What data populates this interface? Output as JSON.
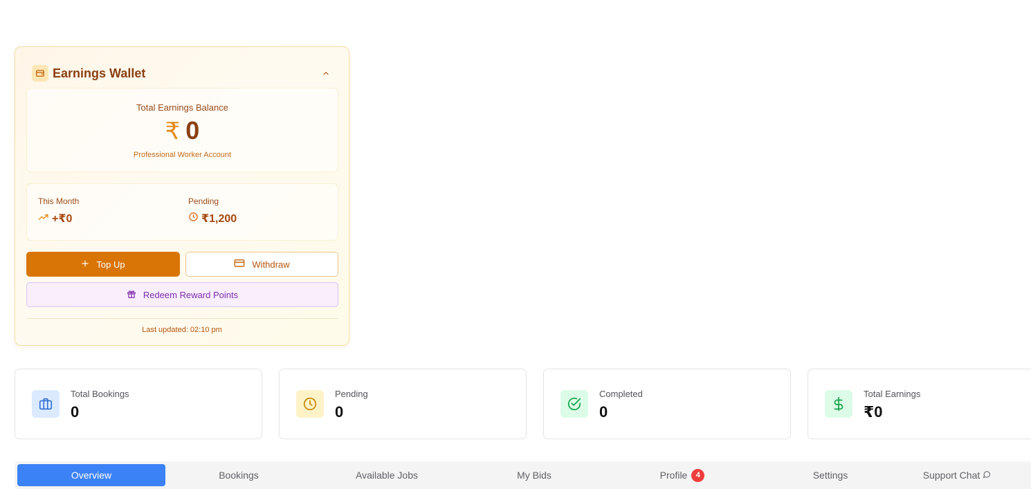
{
  "wallet": {
    "title": "Earnings Wallet",
    "balance_label": "Total Earnings Balance",
    "currency_symbol": "₹",
    "balance_value": "0",
    "account_type": "Professional Worker Account",
    "this_month_label": "This Month",
    "this_month_value": "+₹0",
    "pending_label": "Pending",
    "pending_value": "₹1,200",
    "topup_label": "Top Up",
    "withdraw_label": "Withdraw",
    "redeem_label": "Redeem Reward Points",
    "last_updated": "Last updated: 02:10 pm",
    "icons": [
      "wallet-icon",
      "chevron-up-icon",
      "trending-up-icon",
      "clock-icon",
      "plus-icon",
      "credit-card-icon",
      "gift-icon"
    ]
  },
  "stats": [
    {
      "label": "Total Bookings",
      "value": "0",
      "icon": "briefcase-icon",
      "icon_color": "#2f6fd6",
      "icon_bg": "#dbeafe"
    },
    {
      "label": "Pending",
      "value": "0",
      "icon": "clock-icon",
      "icon_color": "#c9890a",
      "icon_bg": "#fef3c7"
    },
    {
      "label": "Completed",
      "value": "0",
      "icon": "check-circle-icon",
      "icon_color": "#16a34a",
      "icon_bg": "#dcfce7"
    },
    {
      "label": "Total Earnings",
      "value": "₹0",
      "icon": "dollar-icon",
      "icon_color": "#16a34a",
      "icon_bg": "#dcfce7"
    }
  ],
  "tabs": [
    {
      "label": "Overview",
      "active": true
    },
    {
      "label": "Bookings"
    },
    {
      "label": "Available Jobs"
    },
    {
      "label": "My Bids"
    },
    {
      "label": "Profile",
      "badge": "4"
    },
    {
      "label": "Settings"
    },
    {
      "label": "Support Chat",
      "icon": "chat-icon"
    }
  ],
  "colors": {
    "accent": "#3b82f6",
    "wallet_primary": "#d97506",
    "badge": "#ef3d3d"
  }
}
